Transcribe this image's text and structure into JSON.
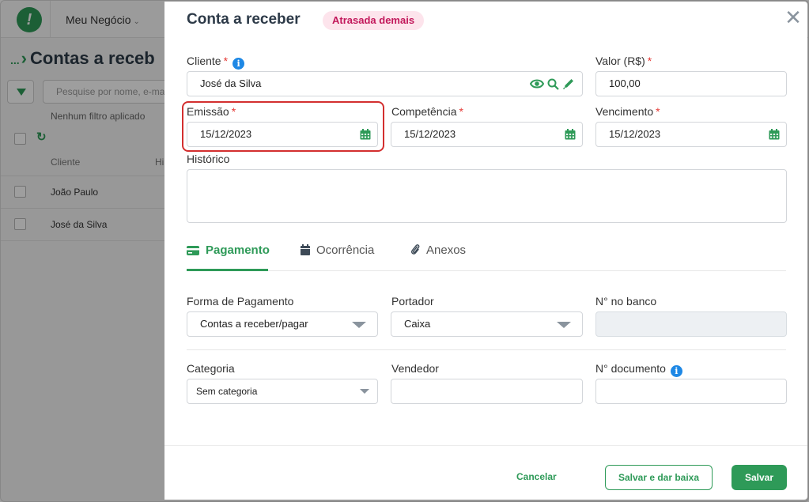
{
  "background": {
    "business_name": "Meu Negócio",
    "breadcrumb_dots": "...",
    "page_title": "Contas a receb",
    "search_placeholder": "Pesquise por nome, e-ma",
    "filter_status": "Nenhum filtro aplicado",
    "columns": [
      "Cliente",
      "Hi"
    ],
    "rows": [
      {
        "name": "João Paulo"
      },
      {
        "name": "José da Silva"
      }
    ]
  },
  "modal": {
    "title": "Conta a receber",
    "status_badge": "Atrasada demais",
    "fields": {
      "cliente": {
        "label": "Cliente",
        "value": "José da Silva"
      },
      "valor": {
        "label": "Valor (R$)",
        "value": "100,00"
      },
      "emissao": {
        "label": "Emissão",
        "value": "15/12/2023"
      },
      "competencia": {
        "label": "Competência",
        "value": "15/12/2023"
      },
      "vencimento": {
        "label": "Vencimento",
        "value": "15/12/2023"
      },
      "historico": {
        "label": "Histórico",
        "value": ""
      }
    },
    "required_mark": "*",
    "tabs": [
      {
        "label": "Pagamento",
        "icon": "credit-card-icon",
        "active": true
      },
      {
        "label": "Ocorrência",
        "icon": "calendar-icon",
        "active": false
      },
      {
        "label": "Anexos",
        "icon": "paperclip-icon",
        "active": false
      }
    ],
    "payment": {
      "forma_label": "Forma de Pagamento",
      "forma_value": "Contas a receber/pagar",
      "portador_label": "Portador",
      "portador_value": "Caixa",
      "banco_label": "N° no banco",
      "banco_value": "",
      "categoria_label": "Categoria",
      "categoria_value": "Sem categoria",
      "vendedor_label": "Vendedor",
      "vendedor_value": "",
      "documento_label": "N° documento",
      "documento_value": ""
    },
    "buttons": {
      "cancel": "Cancelar",
      "save_and_settle": "Salvar e dar baixa",
      "save": "Salvar"
    }
  },
  "colors": {
    "accent": "#2e9a58",
    "required": "#e53935",
    "badge_bg": "#fde4ec",
    "badge_text": "#c2185b",
    "info": "#1e88e5",
    "highlight_border": "#d32f2f"
  }
}
